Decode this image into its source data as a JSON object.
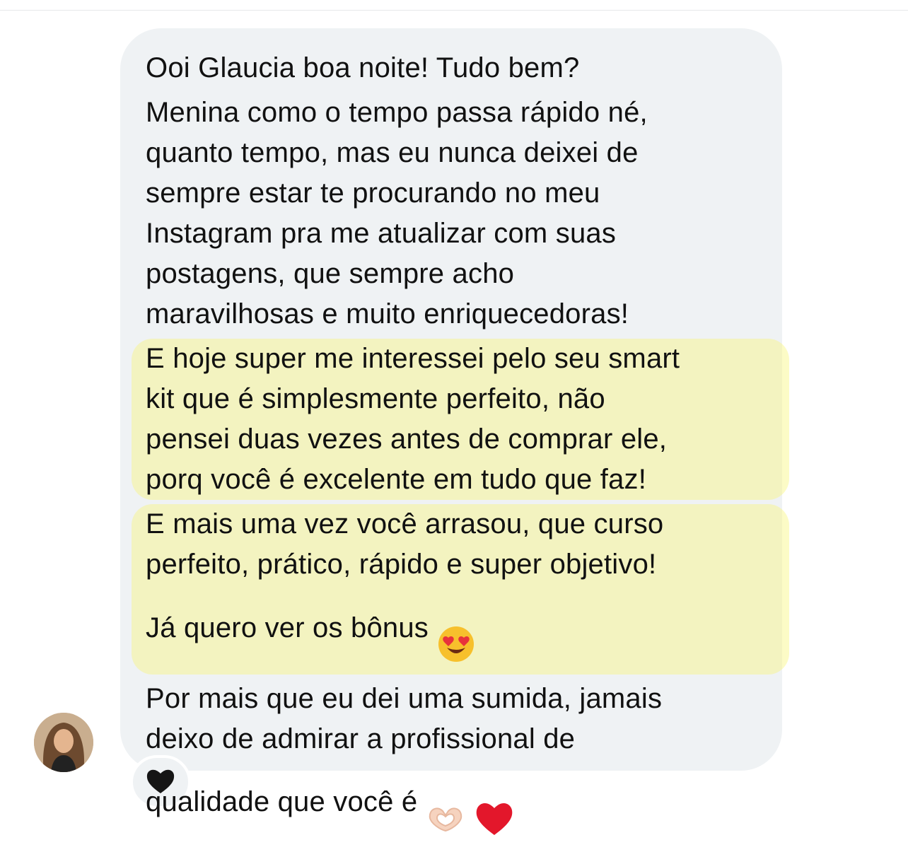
{
  "message": {
    "paragraphs": [
      "Ooi Glaucia boa noite! Tudo bem?",
      "Menina como o tempo passa rápido né,\nquanto tempo, mas eu nunca deixei de\nsempre estar te procurando no meu\nInstagram pra me atualizar com suas\npostagens, que sempre acho\nmaravilhosas e muito enriquecedoras!",
      "E hoje super me interessei pelo seu smart\nkit que é simplesmente perfeito, não\npensei duas vezes antes de comprar ele,\nporq você é excelente em tudo que faz!",
      "E mais uma vez você arrasou, que curso\nperfeito, prático, rápido e super objetivo!\nJá quero ver os bônus",
      "Por mais que eu dei uma sumida, jamais\ndeixo de admirar a profissional de\nqualidade que você é"
    ],
    "emoji_after_p4": "heart-eyes-face",
    "emojis_after_p5": [
      "heart-hands",
      "red-heart"
    ]
  },
  "highlight_color": "#f7f578",
  "bubble_color": "#eff2f4",
  "reaction": {
    "icon": "black-heart-icon"
  },
  "avatar": {
    "icon": "profile-photo"
  }
}
